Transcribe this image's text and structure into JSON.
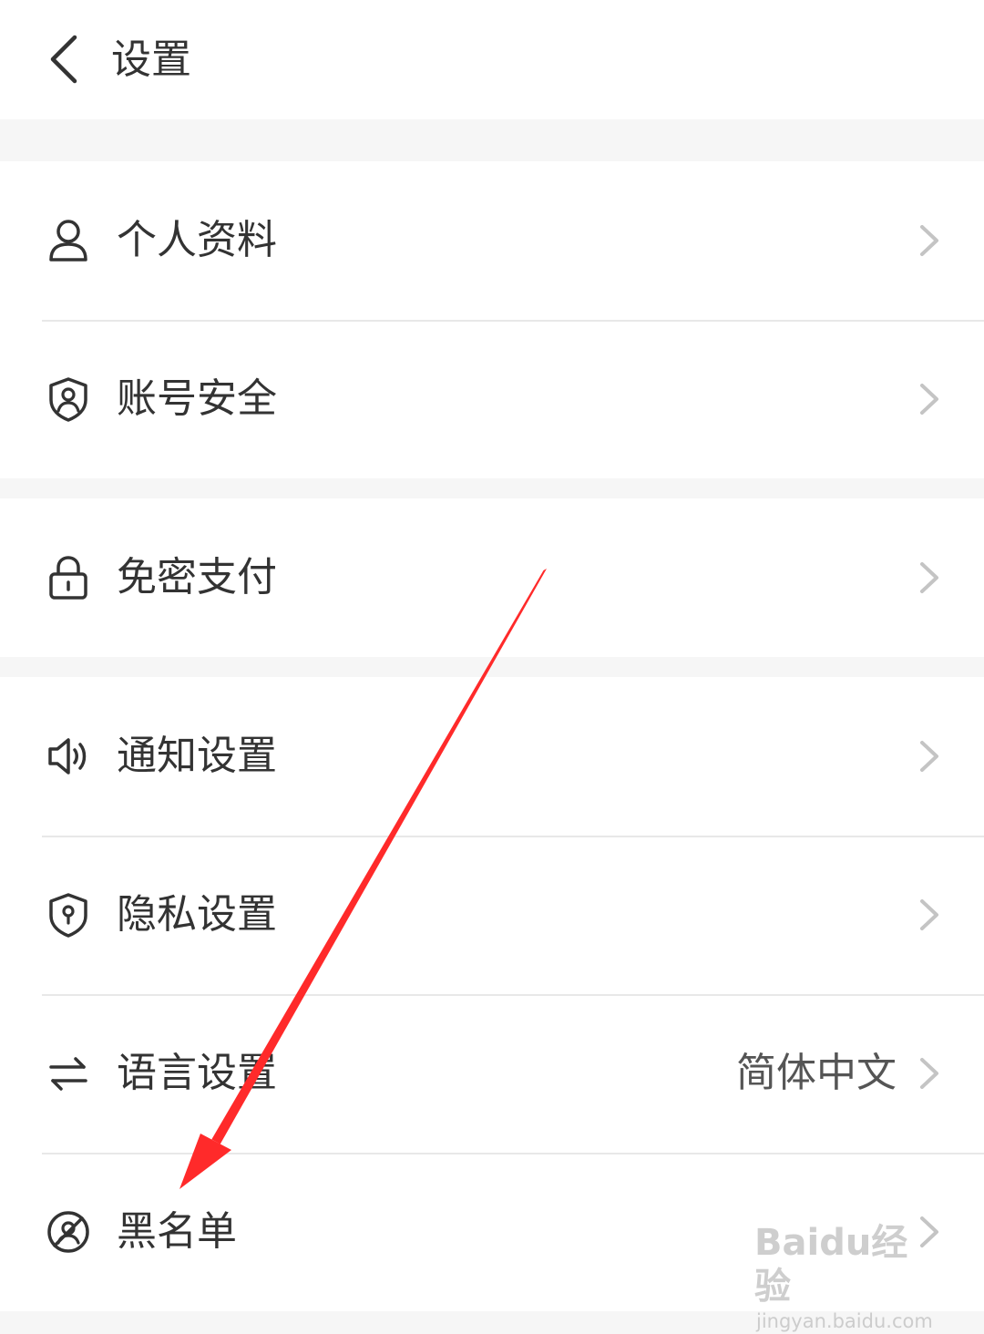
{
  "header": {
    "back_icon": "chevron-left-icon",
    "title": "设置"
  },
  "groups": [
    {
      "items": [
        {
          "label": "个人资料",
          "icon": "user-icon"
        },
        {
          "label": "账号安全",
          "icon": "shield-user-icon"
        }
      ]
    },
    {
      "items": [
        {
          "label": "免密支付",
          "icon": "lock-icon"
        }
      ]
    },
    {
      "items": [
        {
          "label": "通知设置",
          "icon": "speaker-icon"
        },
        {
          "label": "隐私设置",
          "icon": "shield-lock-icon"
        },
        {
          "label": "语言设置",
          "icon": "swap-arrows-icon",
          "value": "简体中文"
        },
        {
          "label": "黑名单",
          "icon": "blocked-user-icon"
        }
      ]
    }
  ],
  "annotation": {
    "type": "red-arrow",
    "color": "#ff2a2a",
    "points_to": "黑名单"
  },
  "watermark": {
    "main": "Baidu经验",
    "sub": "jingyan.baidu.com"
  },
  "colors": {
    "background": "#f6f6f6",
    "surface": "#ffffff",
    "text": "#333333",
    "divider": "#e8e8e8",
    "chevron": "#c4c4c4"
  }
}
